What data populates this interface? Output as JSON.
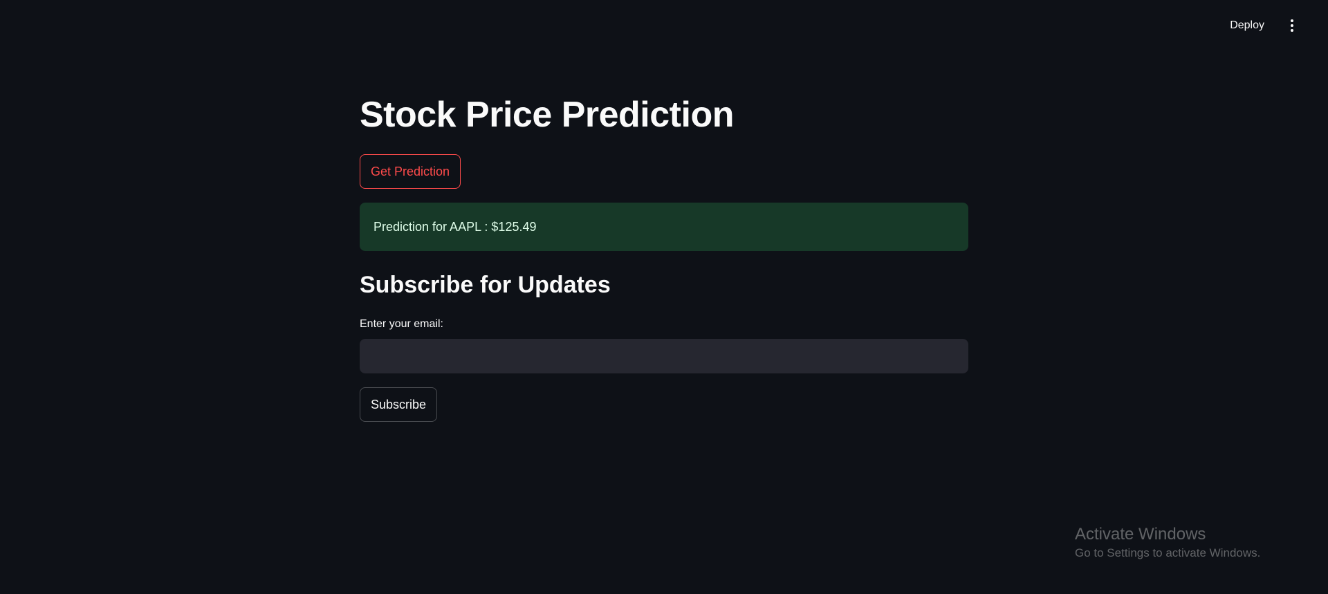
{
  "toolbar": {
    "deploy_label": "Deploy",
    "menu_icon": "kebab-menu-icon"
  },
  "main": {
    "title": "Stock Price Prediction",
    "predict_button_label": "Get Prediction",
    "prediction_message": "Prediction for AAPL : $125.49",
    "subscribe_header": "Subscribe for Updates",
    "email_label": "Enter your email:",
    "email_value": "",
    "subscribe_button_label": "Subscribe"
  },
  "watermark": {
    "title": "Activate Windows",
    "subtitle": "Go to Settings to activate Windows."
  },
  "colors": {
    "background": "#0e1117",
    "accent": "#ff4b4b",
    "success_bg": "#173928",
    "input_bg": "#262730"
  }
}
